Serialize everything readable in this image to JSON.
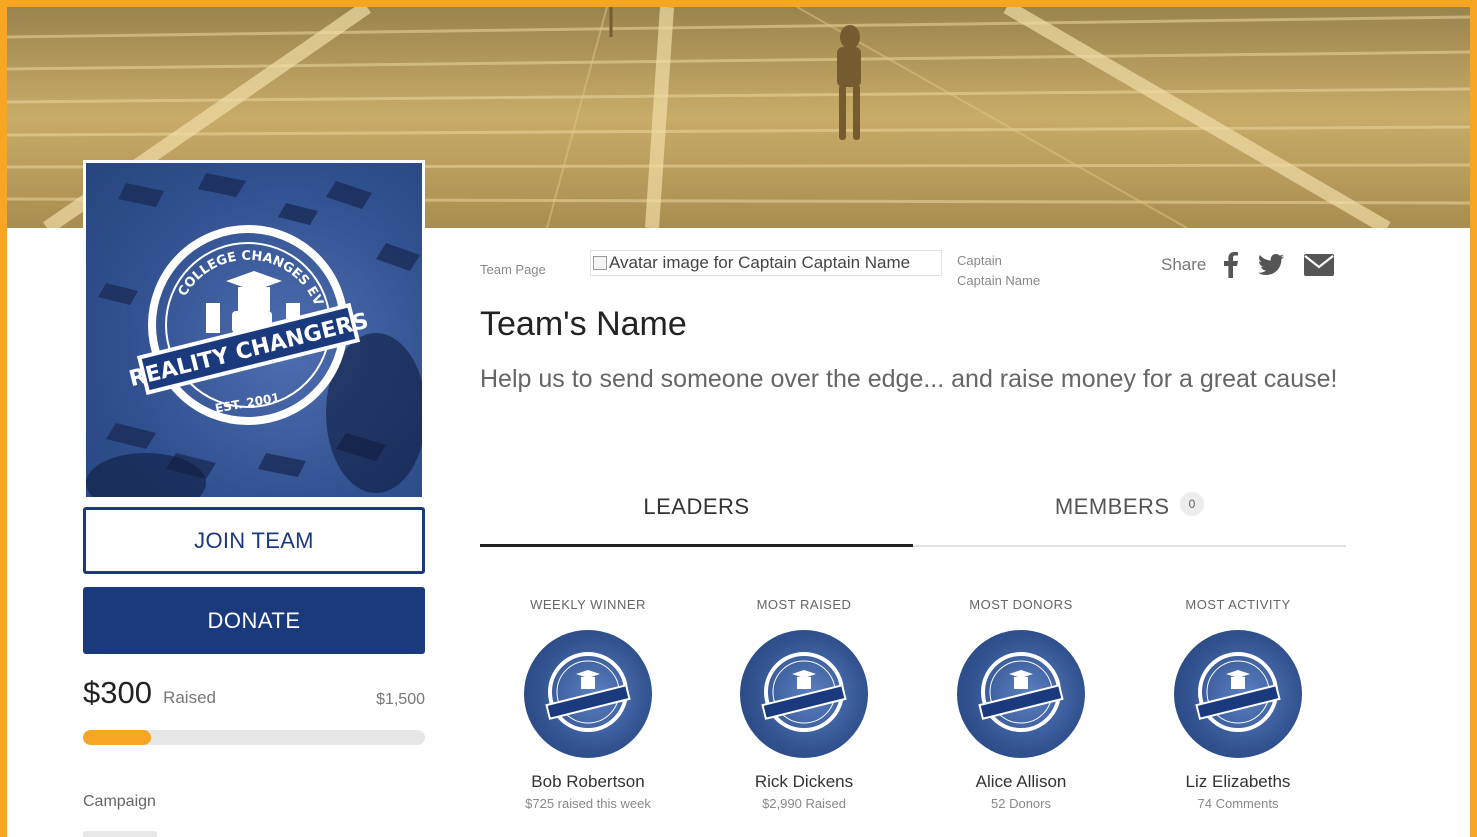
{
  "colors": {
    "frame": "#f6a623",
    "brand": "#1b3a7e",
    "progress": "#f6a623"
  },
  "hero": {
    "alt_description_hidden": ""
  },
  "logo": {
    "arc_text": "COLLEGE CHANGES EVERYTHING",
    "wordmark": "REALITY CHANGERS",
    "est": "EST. 2001"
  },
  "actions": {
    "join_label": "JOIN TEAM",
    "donate_label": "DONATE"
  },
  "fundraising": {
    "raised_amount": "$300",
    "raised_label": "Raised",
    "goal": "$1,500",
    "progress_fraction": 0.2
  },
  "sidebar": {
    "campaign_label": "Campaign"
  },
  "header": {
    "team_page_label": "Team Page",
    "avatar_alt": "Avatar image for Captain Captain Name",
    "captain_label": "Captain",
    "captain_name": "Captain Name",
    "share_label": "Share",
    "share_icons": [
      "facebook-icon",
      "twitter-icon",
      "email-icon"
    ]
  },
  "team": {
    "name": "Team's Name",
    "tagline": "Help us to send someone over the edge... and raise money for a great cause!"
  },
  "tabs": [
    {
      "label": "LEADERS",
      "active": true
    },
    {
      "label": "MEMBERS",
      "count": "0",
      "active": false
    }
  ],
  "leaders": [
    {
      "category": "WEEKLY WINNER",
      "name": "Bob Robertson",
      "stat": "$725 raised this week"
    },
    {
      "category": "MOST RAISED",
      "name": "Rick Dickens",
      "stat": "$2,990 Raised"
    },
    {
      "category": "MOST DONORS",
      "name": "Alice Allison",
      "stat": "52 Donors"
    },
    {
      "category": "MOST ACTIVITY",
      "name": "Liz Elizabeths",
      "stat": "74 Comments"
    }
  ]
}
